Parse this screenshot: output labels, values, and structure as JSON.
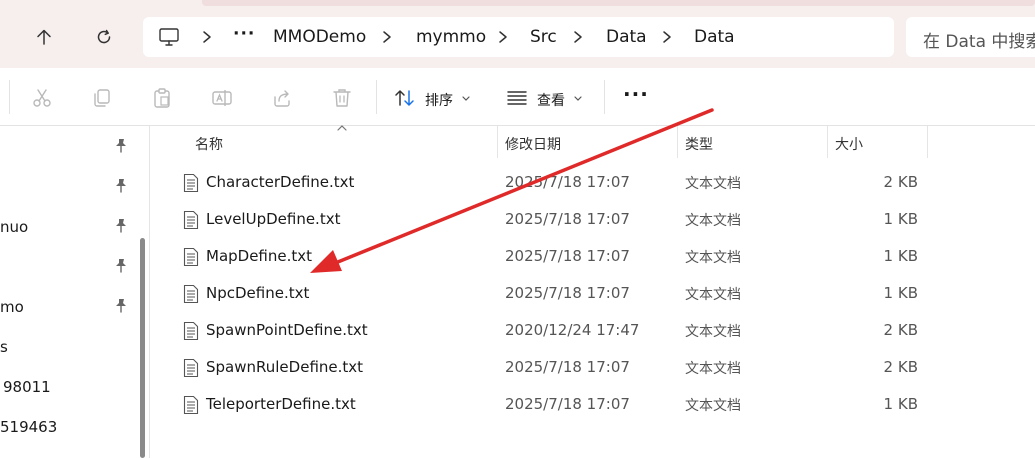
{
  "breadcrumb": {
    "items": [
      "MMODemo",
      "mymmo",
      "Src",
      "Data",
      "Data"
    ],
    "more_label": "···"
  },
  "search": {
    "placeholder": "在 Data 中搜索"
  },
  "toolbar": {
    "sort_label": "排序",
    "view_label": "查看",
    "more_label": "···"
  },
  "sidebar": {
    "items": [
      "",
      "",
      "nuo",
      "",
      "mo",
      "s",
      "98011",
      "519463"
    ]
  },
  "columns": {
    "name": "名称",
    "date": "修改日期",
    "type": "类型",
    "size": "大小"
  },
  "files": [
    {
      "name": "CharacterDefine.txt",
      "date": "2025/7/18 17:07",
      "type": "文本文档",
      "size": "2 KB"
    },
    {
      "name": "LevelUpDefine.txt",
      "date": "2025/7/18 17:07",
      "type": "文本文档",
      "size": "1 KB"
    },
    {
      "name": "MapDefine.txt",
      "date": "2025/7/18 17:07",
      "type": "文本文档",
      "size": "1 KB"
    },
    {
      "name": "NpcDefine.txt",
      "date": "2025/7/18 17:07",
      "type": "文本文档",
      "size": "1 KB"
    },
    {
      "name": "SpawnPointDefine.txt",
      "date": "2020/12/24 17:47",
      "type": "文本文档",
      "size": "2 KB"
    },
    {
      "name": "SpawnRuleDefine.txt",
      "date": "2025/7/18 17:07",
      "type": "文本文档",
      "size": "2 KB"
    },
    {
      "name": "TeleporterDefine.txt",
      "date": "2025/7/18 17:07",
      "type": "文本文档",
      "size": "1 KB"
    }
  ],
  "colors": {
    "annotation_arrow": "#e02a2a",
    "chrome_background": "#f7eeee"
  }
}
